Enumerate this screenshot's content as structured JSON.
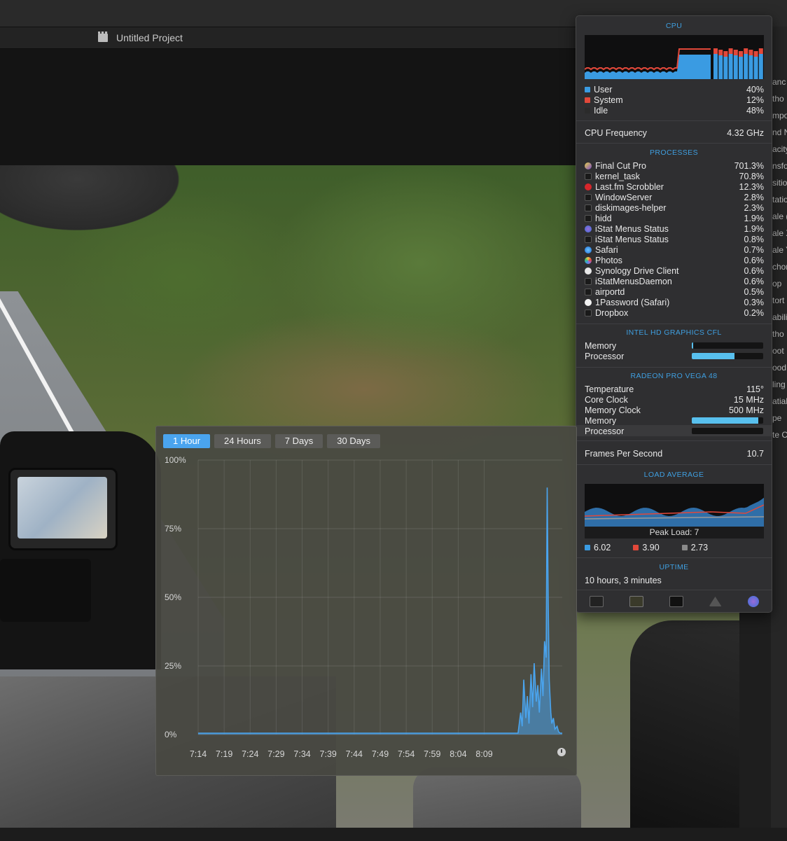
{
  "app": {
    "project_title": "Untitled Project",
    "right_strip": [
      "anc",
      "tho",
      "mpo",
      "nd N",
      "acity",
      "nsfo",
      "sitio",
      "tatio",
      "ale (",
      "ale X",
      "ale Y",
      "chor",
      "op",
      "tort",
      "abiliz",
      "tho",
      "oot",
      "ood",
      "ling",
      "atial",
      "pe",
      "te C"
    ]
  },
  "cpu": {
    "title": "CPU",
    "legend": [
      {
        "label": "User",
        "value": "40%",
        "color": "#3a9be2"
      },
      {
        "label": "System",
        "value": "12%",
        "color": "#e2483a"
      },
      {
        "label": "Idle",
        "value": "48%",
        "color": "#2b2b2b"
      }
    ],
    "frequency_label": "CPU Frequency",
    "frequency_value": "4.32 GHz"
  },
  "processes": {
    "title": "PROCESSES",
    "items": [
      {
        "name": "Final Cut Pro",
        "value": "701.3%",
        "icon": "final-cut-pro-icon"
      },
      {
        "name": "kernel_task",
        "value": "70.8%",
        "icon": "generic-process-icon"
      },
      {
        "name": "Last.fm Scrobbler",
        "value": "12.3%",
        "icon": "lastfm-icon"
      },
      {
        "name": "WindowServer",
        "value": "2.8%",
        "icon": "generic-process-icon"
      },
      {
        "name": "diskimages-helper",
        "value": "2.3%",
        "icon": "generic-process-icon"
      },
      {
        "name": "hidd",
        "value": "1.9%",
        "icon": "generic-process-icon"
      },
      {
        "name": "iStat Menus Status",
        "value": "1.9%",
        "icon": "istat-icon"
      },
      {
        "name": "iStat Menus Status",
        "value": "0.8%",
        "icon": "generic-process-icon"
      },
      {
        "name": "Safari",
        "value": "0.7%",
        "icon": "safari-icon"
      },
      {
        "name": "Photos",
        "value": "0.6%",
        "icon": "photos-icon"
      },
      {
        "name": "Synology Drive Client",
        "value": "0.6%",
        "icon": "synology-icon"
      },
      {
        "name": "iStatMenusDaemon",
        "value": "0.6%",
        "icon": "generic-process-icon"
      },
      {
        "name": "airportd",
        "value": "0.5%",
        "icon": "generic-process-icon"
      },
      {
        "name": "1Password (Safari)",
        "value": "0.3%",
        "icon": "shield-icon"
      },
      {
        "name": "Dropbox",
        "value": "0.2%",
        "icon": "generic-process-icon"
      }
    ]
  },
  "intel_gpu": {
    "title": "INTEL HD GRAPHICS CFL",
    "memory_label": "Memory",
    "memory_level": 0.02,
    "processor_label": "Processor",
    "processor_level": 0.6
  },
  "radeon_gpu": {
    "title": "RADEON PRO VEGA 48",
    "temperature_label": "Temperature",
    "temperature_value": "115°",
    "core_clock_label": "Core Clock",
    "core_clock_value": "15 MHz",
    "memory_clock_label": "Memory Clock",
    "memory_clock_value": "500 MHz",
    "memory_label": "Memory",
    "memory_level": 0.93,
    "processor_label": "Processor",
    "processor_level": 0.0,
    "fps_label": "Frames Per Second",
    "fps_value": "10.7"
  },
  "load_average": {
    "title": "LOAD AVERAGE",
    "peak_label": "Peak Load: 7",
    "values": [
      {
        "value": "6.02",
        "color": "#3a9be2"
      },
      {
        "value": "3.90",
        "color": "#e2483a"
      },
      {
        "value": "2.73",
        "color": "#8a8a8a"
      }
    ]
  },
  "uptime": {
    "title": "UPTIME",
    "value": "10 hours, 3 minutes"
  },
  "history": {
    "tabs": [
      "1 Hour",
      "24 Hours",
      "7 Days",
      "30 Days"
    ],
    "active_tab": 0
  },
  "chart_data": {
    "type": "line",
    "title": "",
    "xlabel": "",
    "ylabel": "",
    "ylim": [
      0,
      100
    ],
    "y_ticks": [
      "100%",
      "75%",
      "50%",
      "25%",
      "0%"
    ],
    "x_ticks": [
      "7:14",
      "7:19",
      "7:24",
      "7:29",
      "7:34",
      "7:39",
      "7:44",
      "7:49",
      "7:54",
      "7:59",
      "8:04",
      "8:09"
    ],
    "grid": true,
    "series": [
      {
        "color": "#4aa4ee",
        "points": [
          [
            0,
            0.5
          ],
          [
            60,
            0.5
          ],
          [
            61.5,
            0.5
          ],
          [
            62,
            8
          ],
          [
            62.3,
            3
          ],
          [
            62.6,
            20
          ],
          [
            63,
            6
          ],
          [
            63.3,
            14
          ],
          [
            63.6,
            4
          ],
          [
            64,
            22
          ],
          [
            64.3,
            10
          ],
          [
            64.6,
            26
          ],
          [
            65,
            12
          ],
          [
            65.3,
            18
          ],
          [
            65.6,
            8
          ],
          [
            66,
            24
          ],
          [
            66.3,
            14
          ],
          [
            66.6,
            34
          ],
          [
            66.9,
            28
          ],
          [
            67.1,
            90
          ],
          [
            67.3,
            50
          ],
          [
            67.5,
            20
          ],
          [
            67.8,
            8
          ],
          [
            68,
            4
          ],
          [
            68.3,
            6
          ],
          [
            68.6,
            2
          ],
          [
            69,
            3
          ],
          [
            69.3,
            1
          ],
          [
            69.6,
            0.5
          ],
          [
            70,
            0.5
          ]
        ]
      }
    ]
  }
}
